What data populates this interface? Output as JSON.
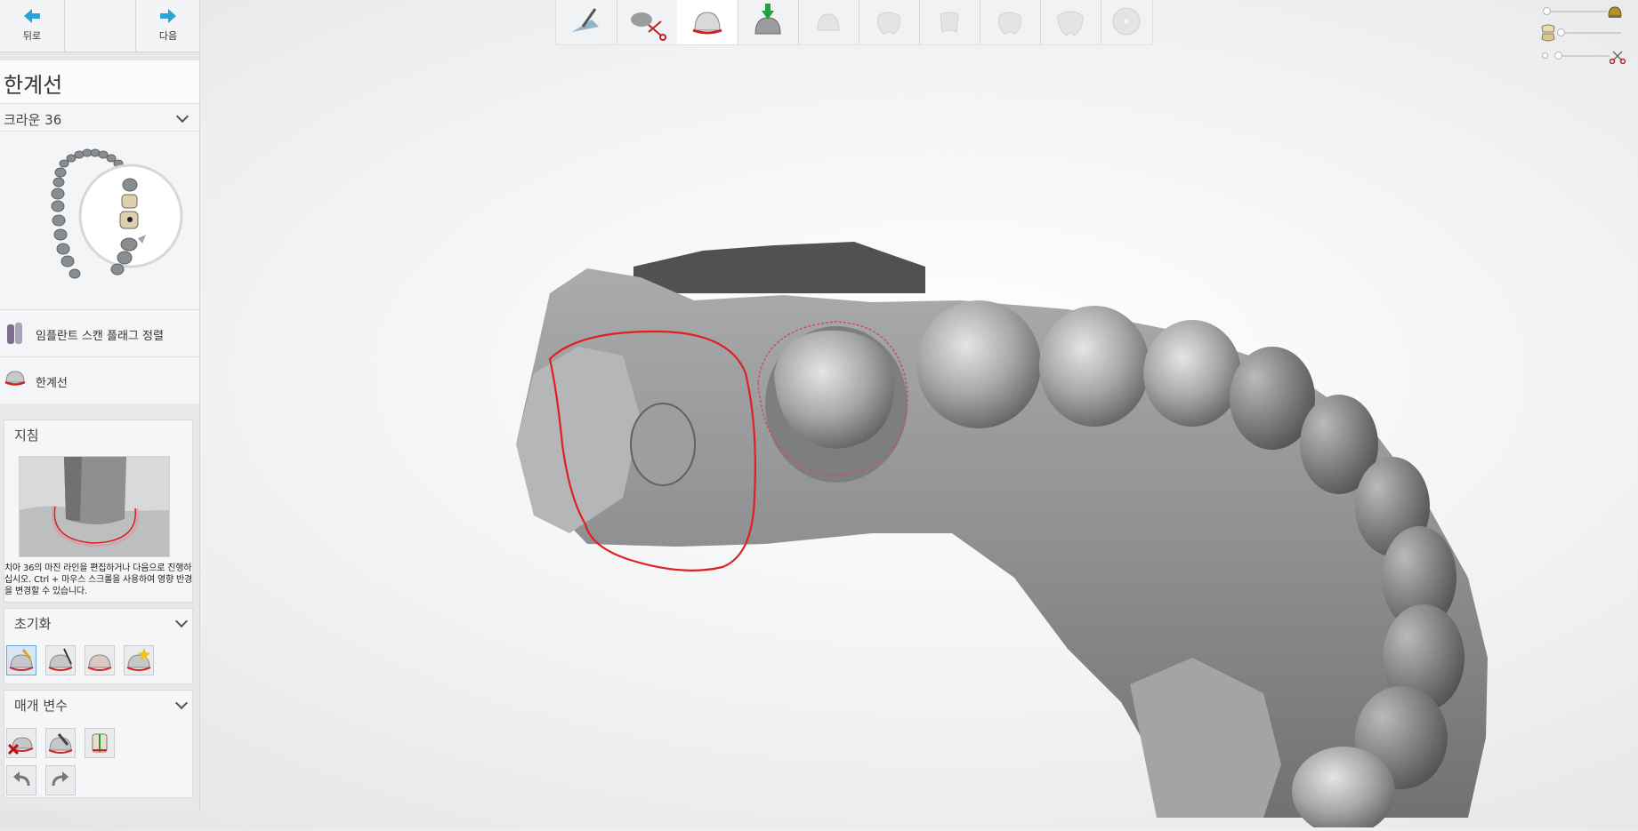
{
  "nav": {
    "back_label": "뒤로",
    "next_label": "다음"
  },
  "panel": {
    "title": "한계선",
    "crown_selector": "크라운 36",
    "steps": [
      {
        "label": "임플란트 스캔 플래그 정렬",
        "icon": "scan-flag-icon"
      },
      {
        "label": "한계선",
        "icon": "margin-line-icon"
      }
    ],
    "guide": {
      "heading": "지침",
      "text": "치아 36의 마진 라인을 편집하거나 다음으로 진행하십시오. Ctrl + 마우스 스크롤을 사용하여 영향 반경을 변경할 수 있습니다."
    },
    "reset": {
      "heading": "초기화",
      "tools": [
        "auto-detect-margin-icon",
        "draw-margin-icon",
        "crown-margin-icon",
        "magic-margin-icon"
      ]
    },
    "params": {
      "heading": "매개 변수",
      "tools": [
        "delete-margin-icon",
        "edit-margin-icon",
        "margin-section-icon"
      ],
      "history": [
        "undo-icon",
        "redo-icon"
      ]
    }
  },
  "toolbar": {
    "steps": [
      {
        "name": "tool-step-preparation",
        "icon": "knife-icon",
        "enabled": true
      },
      {
        "name": "tool-step-trim",
        "icon": "scissors-icon",
        "enabled": true
      },
      {
        "name": "tool-step-margin",
        "icon": "margin-crown-icon",
        "enabled": true,
        "active": true
      },
      {
        "name": "tool-step-insertion",
        "icon": "insertion-axis-icon",
        "enabled": true
      },
      {
        "name": "tool-step-abutment",
        "icon": "abutment-icon",
        "enabled": false
      },
      {
        "name": "tool-step-tooth-1",
        "icon": "tooth-icon",
        "enabled": false
      },
      {
        "name": "tool-step-tooth-2",
        "icon": "tooth-icon",
        "enabled": false
      },
      {
        "name": "tool-step-tooth-3",
        "icon": "tooth-icon",
        "enabled": false
      },
      {
        "name": "tool-step-tooth-4",
        "icon": "tooth-icon",
        "enabled": false
      },
      {
        "name": "tool-step-export",
        "icon": "disc-icon",
        "enabled": false
      }
    ]
  },
  "right_controls": {
    "sliders": [
      {
        "name": "crown-opacity-slider",
        "icon": "crown-icon",
        "level": 0.0
      },
      {
        "name": "jaw-opacity-slider",
        "icon": "tooth-pair-icon",
        "level": 0.0
      },
      {
        "name": "trim-slider",
        "icon": "scissors-icon",
        "level": 0.0
      }
    ]
  },
  "colors": {
    "accent": "#2aa3d6",
    "margin_line": "#e02020",
    "active_tool": "#6fa4d6"
  }
}
